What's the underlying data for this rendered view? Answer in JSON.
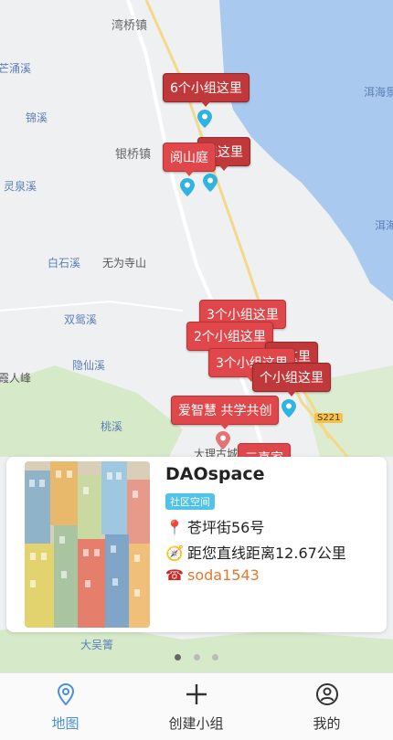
{
  "map": {
    "places": [
      {
        "name": "湾桥镇",
        "cls": "town"
      },
      {
        "name": "芒涌溪",
        "cls": ""
      },
      {
        "name": "锦溪",
        "cls": ""
      },
      {
        "name": "银桥镇",
        "cls": "town"
      },
      {
        "name": "灵泉溪",
        "cls": ""
      },
      {
        "name": "白石溪",
        "cls": ""
      },
      {
        "name": "无为寺山",
        "cls": "dark"
      },
      {
        "name": "双鸳溪",
        "cls": ""
      },
      {
        "name": "隐仙溪",
        "cls": ""
      },
      {
        "name": "霞人峰",
        "cls": "dark"
      },
      {
        "name": "桃溪",
        "cls": ""
      },
      {
        "name": "洱海",
        "cls": ""
      },
      {
        "name": "洱海景",
        "cls": ""
      },
      {
        "name": "大理古城",
        "cls": "dark"
      },
      {
        "name": "大吴箐",
        "cls": ""
      }
    ],
    "road_label": "S221",
    "bubbles": [
      {
        "text": "6个小组这里",
        "style": "dark"
      },
      {
        "text": "组这里",
        "style": "dark"
      },
      {
        "text": "阅山庭",
        "style": "light"
      },
      {
        "text": "3个小组这里",
        "style": "light"
      },
      {
        "text": "2个小组这里",
        "style": "light"
      },
      {
        "text": "组这里",
        "style": "dark"
      },
      {
        "text": "3个小组这里",
        "style": "light"
      },
      {
        "text": "个小组这里",
        "style": "dark"
      },
      {
        "text": "爱智慧 共学共创",
        "style": "light"
      },
      {
        "text": "三喜家",
        "style": "light"
      }
    ]
  },
  "card": {
    "title": "DAOspace",
    "tag": "社区空间",
    "address_icon": "pin-icon",
    "address": "苍坪街56号",
    "distance_icon": "compass-icon",
    "distance": "距您直线距离12.67公里",
    "contact_icon": "telephone-icon",
    "contact": "soda1543"
  },
  "pagination": {
    "count": 3,
    "active": 0
  },
  "tabs": [
    {
      "label": "地图",
      "icon": "map-pin-icon",
      "active": true
    },
    {
      "label": "创建小组",
      "icon": "plus-icon",
      "active": false
    },
    {
      "label": "我的",
      "icon": "user-icon",
      "active": false
    }
  ],
  "colors": {
    "accent": "#4a90d9",
    "marker": "#c0383a",
    "tag": "#4fc3e8",
    "contact": "#e8772e",
    "lake": "#a9c9ef"
  }
}
